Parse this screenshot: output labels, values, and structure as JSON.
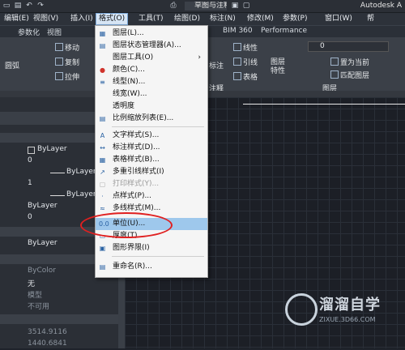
{
  "title_bar": {
    "workspace": "草图与注释",
    "app_title": "Autodesk A",
    "quick_access_icons": [
      "new-icon",
      "open-icon",
      "save-icon",
      "save-as-icon",
      "print-icon",
      "undo-icon",
      "redo-icon"
    ]
  },
  "menu_bar": {
    "items": [
      "编辑(E)",
      "视图(V)",
      "插入(I)",
      "格式(O)",
      "工具(T)",
      "绘图(D)",
      "标注(N)",
      "修改(M)",
      "参数(P)",
      "窗口(W)",
      "帮"
    ]
  },
  "ribbon_tabs": [
    "参数化",
    "视图",
    "BIM 360",
    "Performance"
  ],
  "ribbon": {
    "modify_items": [
      "移动",
      "复制",
      "拉伸"
    ],
    "circle_label": "圆弧",
    "annotation": [
      "线性",
      "引线",
      "表格",
      "标注"
    ],
    "annotation_panel": "注释",
    "layer_props": "图层\n特性",
    "layer_combo": "0",
    "layer_actions": [
      "置为当前",
      "匹配图层"
    ],
    "layer_panel": "图层"
  },
  "properties": {
    "rows": [
      "ByLayer",
      "0",
      "ByLayer",
      "1",
      "ByLayer",
      "ByLayer",
      "0",
      "ByLayer"
    ],
    "dim_rows": [
      "ByColor",
      "无",
      "模型",
      "不可用"
    ],
    "coords": [
      "3514.9116",
      "1440.6841"
    ]
  },
  "dropdown": {
    "items": [
      {
        "label": "图层(L)...",
        "icon": "layer-icon"
      },
      {
        "label": "图层状态管理器(A)...",
        "icon": "layer-state-icon"
      },
      {
        "label": "图层工具(O)",
        "icon": "layer-tools-icon",
        "submenu": true
      },
      {
        "label": "颜色(C)...",
        "icon": "color-icon"
      },
      {
        "label": "线型(N)...",
        "icon": "linetype-icon"
      },
      {
        "label": "线宽(W)...",
        "icon": "lineweight-icon"
      },
      {
        "label": "透明度",
        "icon": ""
      },
      {
        "label": "比例缩放列表(E)...",
        "icon": "scale-list-icon"
      },
      {
        "label": "文字样式(S)...",
        "icon": "text-style-icon"
      },
      {
        "label": "标注样式(D)...",
        "icon": "dim-style-icon"
      },
      {
        "label": "表格样式(B)...",
        "icon": "table-style-icon"
      },
      {
        "label": "多重引线样式(I)",
        "icon": "mleader-style-icon"
      },
      {
        "label": "打印样式(Y)...",
        "icon": "plot-style-icon",
        "disabled": true
      },
      {
        "label": "点样式(P)...",
        "icon": "point-style-icon"
      },
      {
        "label": "多线样式(M)...",
        "icon": "mline-style-icon"
      },
      {
        "label": "单位(U)...",
        "icon": "units-icon",
        "highlighted": true
      },
      {
        "label": "厚度(T)",
        "icon": "thickness-icon"
      },
      {
        "label": "图形界限(I)",
        "icon": "limits-icon"
      },
      {
        "label": "重命名(R)...",
        "icon": "rename-icon"
      }
    ]
  },
  "watermark": {
    "title": "溜溜自学",
    "url": "ZIXUE.3D66.COM"
  },
  "colors": {
    "highlight": "#9ec8ec",
    "ellipse": "#e02020",
    "background": "#1c1f26"
  }
}
